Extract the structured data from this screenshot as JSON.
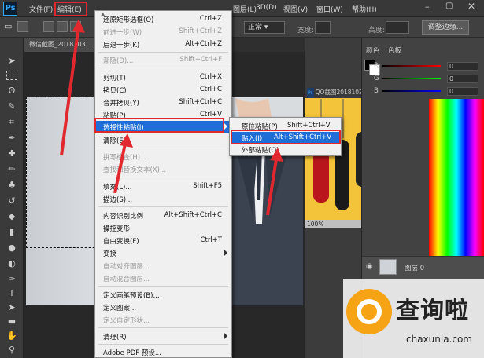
{
  "menubar": {
    "logo": "Ps",
    "items": [
      "文件(F)",
      "编辑(E)",
      "图层(L)",
      "3D(D)",
      "视图(V)",
      "窗口(W)",
      "帮助(H)"
    ]
  },
  "options": {
    "mode_select": "正常",
    "width_label": "宽度:",
    "height_label": "高度:",
    "refine_button": "调整边缘..."
  },
  "document": {
    "tab": "微信截图_2018103...",
    "float_title": "QQ截图20181023231346p...",
    "float_zoom": "100%"
  },
  "edit_menu": {
    "items": [
      {
        "label": "还原矩形选框(O)",
        "shortcut": "Ctrl+Z",
        "disabled": false
      },
      {
        "label": "前进一步(W)",
        "shortcut": "Shift+Ctrl+Z",
        "disabled": true
      },
      {
        "label": "后退一步(K)",
        "shortcut": "Alt+Ctrl+Z",
        "disabled": false
      },
      {
        "label": "渐隐(D)...",
        "shortcut": "Shift+Ctrl+F",
        "disabled": true
      },
      {
        "label": "剪切(T)",
        "shortcut": "Ctrl+X",
        "disabled": false
      },
      {
        "label": "拷贝(C)",
        "shortcut": "Ctrl+C",
        "disabled": false
      },
      {
        "label": "合并拷贝(Y)",
        "shortcut": "Shift+Ctrl+C",
        "disabled": false
      },
      {
        "label": "粘贴(P)",
        "shortcut": "Ctrl+V",
        "disabled": false
      },
      {
        "label": "选择性粘贴(I)",
        "shortcut": "",
        "disabled": false,
        "active": true
      },
      {
        "label": "清除(E)",
        "shortcut": "",
        "disabled": false
      },
      {
        "label": "拼写检查(H)...",
        "shortcut": "",
        "disabled": true
      },
      {
        "label": "查找和替换文本(X)...",
        "shortcut": "",
        "disabled": true
      },
      {
        "label": "填充(L)...",
        "shortcut": "Shift+F5",
        "disabled": false
      },
      {
        "label": "描边(S)...",
        "shortcut": "",
        "disabled": false
      },
      {
        "label": "内容识别比例",
        "shortcut": "Alt+Shift+Ctrl+C",
        "disabled": false
      },
      {
        "label": "操控变形",
        "shortcut": "",
        "disabled": false
      },
      {
        "label": "自由变换(F)",
        "shortcut": "Ctrl+T",
        "disabled": false
      },
      {
        "label": "变换",
        "shortcut": "",
        "disabled": false
      },
      {
        "label": "自动对齐图层...",
        "shortcut": "",
        "disabled": true
      },
      {
        "label": "自动混合图层...",
        "shortcut": "",
        "disabled": true
      },
      {
        "label": "定义画笔预设(B)...",
        "shortcut": "",
        "disabled": false
      },
      {
        "label": "定义图案...",
        "shortcut": "",
        "disabled": false
      },
      {
        "label": "定义自定形状...",
        "shortcut": "",
        "disabled": true
      },
      {
        "label": "清理(R)",
        "shortcut": "",
        "disabled": false
      },
      {
        "label": "Adobe PDF 预设...",
        "shortcut": "",
        "disabled": false
      }
    ]
  },
  "submenu": {
    "items": [
      {
        "label": "原位粘贴(P)",
        "shortcut": "Shift+Ctrl+V"
      },
      {
        "label": "贴入(I)",
        "shortcut": "Alt+Shift+Ctrl+V",
        "active": true
      },
      {
        "label": "外部粘贴(O)",
        "shortcut": ""
      }
    ]
  },
  "panels": {
    "color_tab": "颜色",
    "swatches_tab": "色板",
    "r_label": "R",
    "g_label": "G",
    "b_label": "B",
    "r_value": "0",
    "g_value": "0",
    "b_value": "0",
    "layer_name": "图层 0"
  },
  "watermark": {
    "title": "查询啦",
    "url": "chaxunla.com"
  },
  "colors": {
    "highlight": "#1f6ed8",
    "callout": "#e0282e",
    "watermark_accent": "#f7a316"
  }
}
